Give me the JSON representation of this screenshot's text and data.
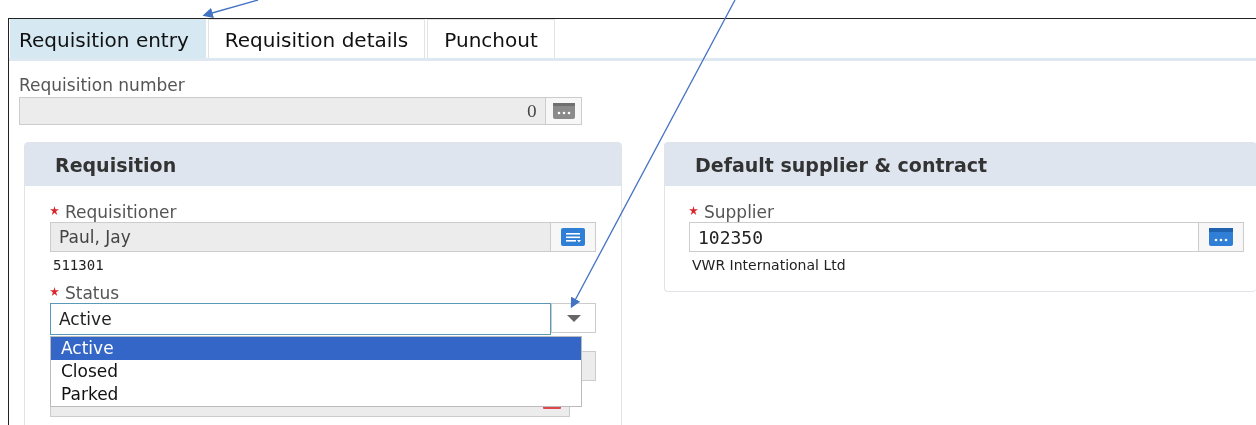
{
  "tabs": [
    {
      "label": "Requisition entry",
      "selected": true
    },
    {
      "label": "Requisition details",
      "selected": false
    },
    {
      "label": "Punchout",
      "selected": false
    }
  ],
  "requisition_number": {
    "label": "Requisition number",
    "value": "0"
  },
  "requisition_panel": {
    "title": "Requisition",
    "requisitioner": {
      "label": "Requisitioner",
      "required": true,
      "value": "Paul, Jay",
      "code": "511301"
    },
    "status": {
      "label": "Status",
      "required": true,
      "value": "Active",
      "expanded": true,
      "options": [
        {
          "label": "Active",
          "selected": true
        },
        {
          "label": "Closed",
          "selected": false
        },
        {
          "label": "Parked",
          "selected": false
        }
      ]
    }
  },
  "supplier_panel": {
    "title": "Default supplier & contract",
    "supplier": {
      "label": "Supplier",
      "required": true,
      "value": "102350",
      "name": "VWR International Ltd"
    }
  }
}
